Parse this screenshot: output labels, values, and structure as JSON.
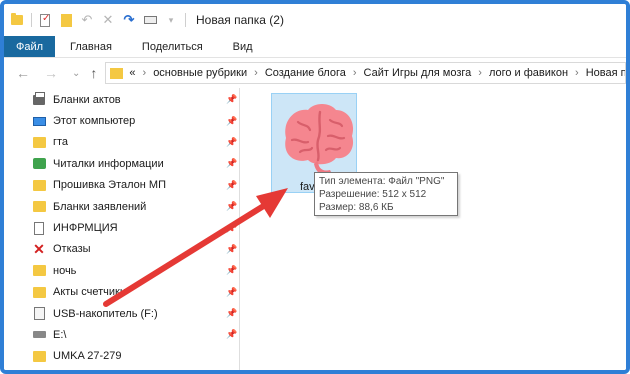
{
  "titlebar": {
    "title": "Новая папка (2)",
    "quick_access_icons": [
      "folder-icon",
      "properties-icon",
      "new-folder-icon",
      "undo-icon",
      "delete-icon",
      "redo-icon",
      "rename-icon",
      "customize-dropdown-icon"
    ]
  },
  "ribbon": {
    "tabs": [
      {
        "label": "Файл"
      },
      {
        "label": "Главная"
      },
      {
        "label": "Поделиться"
      },
      {
        "label": "Вид"
      }
    ]
  },
  "address_bar": {
    "overflow": "«",
    "crumbs": [
      "основные рубрики",
      "Создание блога",
      "Сайт Игры для мозга",
      "лого и фавикон",
      "Новая папка"
    ]
  },
  "nav_pane": {
    "items": [
      {
        "label": "Бланки актов",
        "icon": "printer-icon"
      },
      {
        "label": "Этот компьютер",
        "icon": "computer-icon"
      },
      {
        "label": "гта",
        "icon": "folder-icon"
      },
      {
        "label": "Читалки информации",
        "icon": "green-folder-icon"
      },
      {
        "label": "Прошивка Эталон МП",
        "icon": "folder-icon"
      },
      {
        "label": "Бланки заявлений",
        "icon": "folder-icon"
      },
      {
        "label": "ИНФРМЦИЯ",
        "icon": "document-icon"
      },
      {
        "label": "Отказы",
        "icon": "red-x-icon"
      },
      {
        "label": "ночь",
        "icon": "folder-icon"
      },
      {
        "label": "Акты счетчики",
        "icon": "folder-icon"
      },
      {
        "label": "USB-накопитель (F:)",
        "icon": "usb-drive-icon"
      },
      {
        "label": "E:\\",
        "icon": "drive-icon"
      },
      {
        "label": "UMKA 27-279",
        "icon": "folder-icon"
      }
    ]
  },
  "content": {
    "file": {
      "name": "fav",
      "icon": "brain-image-icon",
      "selected": true
    },
    "tooltip": {
      "type_line": "Тип элемента: Файл \"PNG\"",
      "resolution_line": "Разрешение: 512 x 512",
      "size_line": "Размер: 88,6 КБ"
    }
  },
  "colors": {
    "frame": "#2f7fd6",
    "file_tab": "#19699f",
    "selection": "#cde6f7",
    "arrow": "#e53935",
    "brain": "#f5868f"
  }
}
